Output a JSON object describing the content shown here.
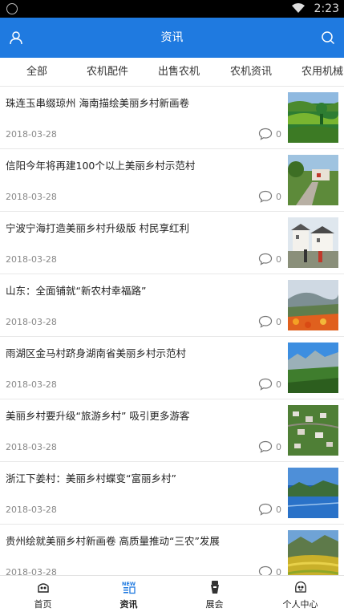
{
  "status_bar": {
    "time": "2:23"
  },
  "header": {
    "title": "资讯",
    "bg_color": "#1f7ae0"
  },
  "tabs": [
    {
      "label": "全部"
    },
    {
      "label": "农机配件"
    },
    {
      "label": "出售农机"
    },
    {
      "label": "农机资讯"
    },
    {
      "label": "农用机械"
    }
  ],
  "articles": [
    {
      "title": "珠连玉串缀琼州 海南描绘美丽乡村新画卷",
      "date": "2018-03-28",
      "comments": "0",
      "thumb": "green-fields"
    },
    {
      "title": "信阳今年将再建100个以上美丽乡村示范村",
      "date": "2018-03-28",
      "comments": "0",
      "thumb": "village-road"
    },
    {
      "title": "宁波宁海打造美丽乡村升级版 村民享红利",
      "date": "2018-03-28",
      "comments": "0",
      "thumb": "village-houses"
    },
    {
      "title": "山东：全面铺就“新农村幸福路”",
      "date": "2018-03-28",
      "comments": "0",
      "thumb": "mountain-flowers"
    },
    {
      "title": "雨湖区金马村跻身湖南省美丽乡村示范村",
      "date": "2018-03-28",
      "comments": "0",
      "thumb": "blue-sky-hills"
    },
    {
      "title": "美丽乡村要升级“旅游乡村” 吸引更多游客",
      "date": "2018-03-28",
      "comments": "0",
      "thumb": "aerial-village"
    },
    {
      "title": "浙江下姜村：美丽乡村蝶变“富丽乡村”",
      "date": "2018-03-28",
      "comments": "0",
      "thumb": "lake-mountains"
    },
    {
      "title": "贵州绘就美丽乡村新画卷 高质量推动“三农”发展",
      "date": "2018-03-28",
      "comments": "0",
      "thumb": "terrace-fields"
    }
  ],
  "bottom_nav": [
    {
      "label": "首页",
      "icon": "home-icon"
    },
    {
      "label": "资讯",
      "icon": "news-icon",
      "badge": "NEW"
    },
    {
      "label": "展会",
      "icon": "exhibition-icon"
    },
    {
      "label": "个人中心",
      "icon": "profile-icon"
    }
  ]
}
